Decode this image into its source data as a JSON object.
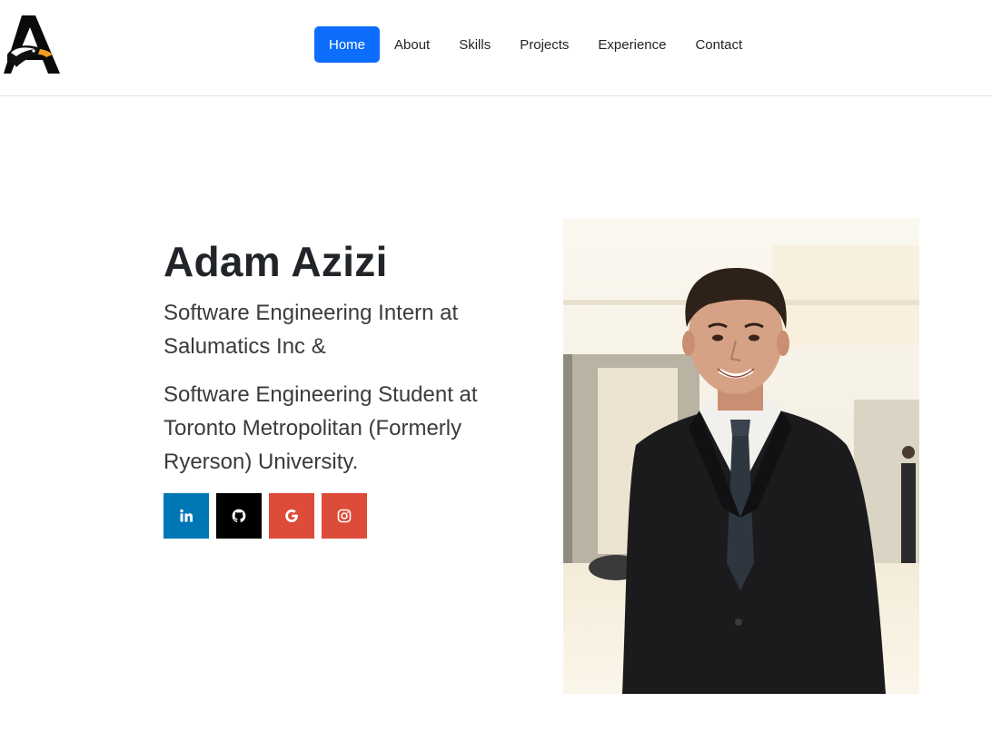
{
  "nav": {
    "items": [
      {
        "label": "Home",
        "active": true
      },
      {
        "label": "About",
        "active": false
      },
      {
        "label": "Skills",
        "active": false
      },
      {
        "label": "Projects",
        "active": false
      },
      {
        "label": "Experience",
        "active": false
      },
      {
        "label": "Contact",
        "active": false
      }
    ],
    "active_color": "#0d6efd",
    "logo_letter": "A"
  },
  "hero": {
    "name": "Adam Azizi",
    "line1": "Software Engineering Intern at Salumatics Inc &",
    "line2": "Software Engineering Student at Toronto Metropolitan (Formerly Ryerson) University."
  },
  "socials": [
    {
      "icon": "linkedin-icon",
      "label": "in",
      "color": "#0077b5"
    },
    {
      "icon": "github-icon",
      "color": "#000000"
    },
    {
      "icon": "google-icon",
      "label": "G",
      "color": "#dd4b39"
    },
    {
      "icon": "instagram-icon",
      "color": "#dd4b39"
    }
  ]
}
